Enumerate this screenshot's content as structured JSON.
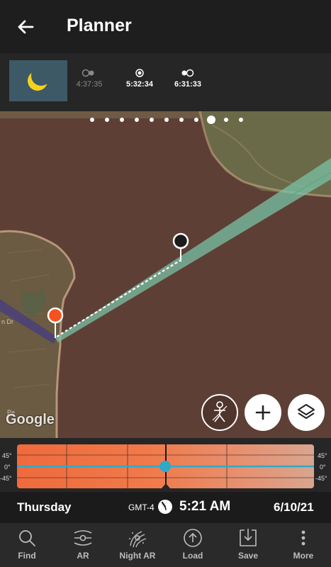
{
  "appbar": {
    "title": "Planner"
  },
  "phases": {
    "moonrise": "4:37:35",
    "transit": "5:32:34",
    "moonset": "6:31:33"
  },
  "map": {
    "attribution": "Google",
    "page_count": 11,
    "active_page_index": 8
  },
  "timeline": {
    "left_labels": [
      "45°",
      "0°",
      "-45°"
    ],
    "right_labels": [
      "45°",
      "0°",
      "-45°"
    ]
  },
  "info": {
    "day": "Thursday",
    "timezone": "GMT-4",
    "time": "5:21 AM",
    "date": "6/10/21"
  },
  "nav": {
    "items": [
      "Find",
      "AR",
      "Night AR",
      "Load",
      "Save",
      "More"
    ]
  },
  "colors": {
    "accent": "#2fa9c9",
    "sun_pin": "#f4521e",
    "azimuth_band": "#7bc2a6"
  }
}
